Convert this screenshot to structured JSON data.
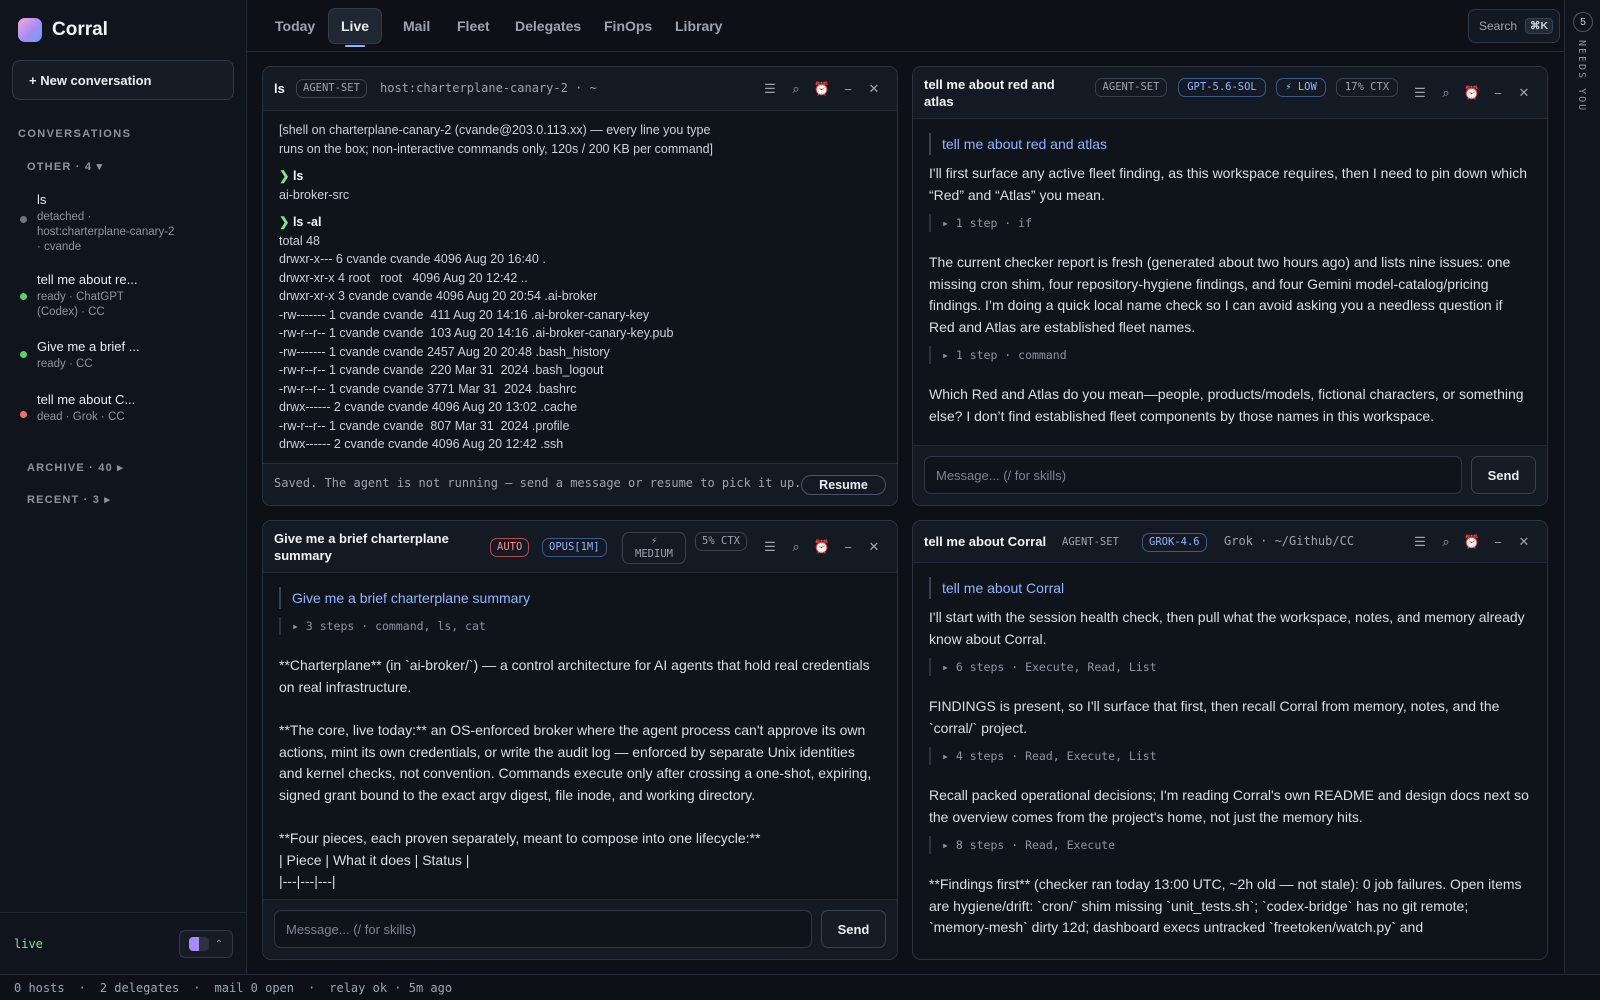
{
  "app": {
    "name": "Corral"
  },
  "sidebar": {
    "new_conversation": "+ New conversation",
    "conversations_label": "CONVERSATIONS",
    "groups": {
      "other": "OTHER · 4 ▾",
      "archive": "ARCHIVE · 40 ▸",
      "recent": "RECENT · 3 ▸"
    },
    "items": [
      {
        "title": "ls",
        "sub": "detached · host:charterplane-canary-2 · cvande",
        "status_color": "#6e7681"
      },
      {
        "title": "tell me about re...",
        "sub": "ready · ChatGPT (Codex) · CC",
        "status_color": "#56d364"
      },
      {
        "title": "Give me a brief ...",
        "sub": "ready · CC",
        "status_color": "#56d364"
      },
      {
        "title": "tell me about C...",
        "sub": "dead · Grok · CC",
        "status_color": "#f47067"
      }
    ],
    "footer": {
      "live_label": "live",
      "toggle_caret": "⌃"
    }
  },
  "nav": {
    "tabs": [
      "Today",
      "Live",
      "Mail",
      "Fleet",
      "Delegates",
      "FinOps",
      "Library"
    ],
    "active": "Live",
    "search_label": "Search",
    "search_kbd": "⌘K"
  },
  "rail": {
    "count": "5",
    "label": "NEEDS YOU"
  },
  "status": [
    "0 hosts",
    "·",
    "2 delegates",
    "·",
    "mail 0 open",
    "·",
    "relay ok · 5m ago"
  ],
  "panes": {
    "ls": {
      "title": "ls",
      "badge": "AGENT-SET",
      "host": "host:charterplane-canary-2 · ~",
      "banner": "[shell on charterplane-canary-2 (cvande@203.0.113.xx) — every line you type\nruns on the box; non-interactive commands only, 120s / 200 KB per command]",
      "cmd1": "ls",
      "out1": "ai-broker-src",
      "cmd2": "ls -al",
      "out2": "total 48\ndrwxr-x--- 6 cvande cvande 4096 Aug 20 16:40 .\ndrwxr-xr-x 4 root   root   4096 Aug 20 12:42 ..\ndrwxr-xr-x 3 cvande cvande 4096 Aug 20 20:54 .ai-broker\n-rw------- 1 cvande cvande  411 Aug 20 14:16 .ai-broker-canary-key\n-rw-r--r-- 1 cvande cvande  103 Aug 20 14:16 .ai-broker-canary-key.pub\n-rw------- 1 cvande cvande 2457 Aug 20 20:48 .bash_history\n-rw-r--r-- 1 cvande cvande  220 Mar 31  2024 .bash_logout\n-rw-r--r-- 1 cvande cvande 3771 Mar 31  2024 .bashrc\ndrwx------ 2 cvande cvande 4096 Aug 20 13:02 .cache\n-rw-r--r-- 1 cvande cvande  807 Mar 31  2024 .profile\ndrwx------ 2 cvande cvande 4096 Aug 20 12:42 .ssh",
      "footer_note": "Saved. The agent is not running — send a message or resume to pick it up.",
      "resume": "Resume"
    },
    "redatlas": {
      "title": "tell me about red and atlas",
      "badges": [
        "AGENT-SET",
        "GPT-5.6-SOL",
        "⚡ LOW",
        "17% CTX"
      ],
      "quote": "tell me about red and atlas",
      "p1": "I'll first surface any active fleet finding, as this workspace requires, then I need to pin down which “Red” and “Atlas” you mean.",
      "s1": "▸ 1 step · if",
      "p2": "The current checker report is fresh (generated about two hours ago) and lists nine issues: one missing cron shim, four repository-hygiene findings, and four Gemini model-catalog/pricing findings. I’m doing a quick local name check so I can avoid asking you a needless question if Red and Atlas are established fleet names.",
      "s2": "▸ 1 step · command",
      "p3": "Which Red and Atlas do you mean—people, products/models, fictional characters, or something else? I don’t find established fleet components by those names in this workspace.",
      "placeholder": "Message...  (/ for skills)",
      "send": "Send"
    },
    "charter": {
      "title": "Give me a brief charterplane summary",
      "badges": [
        "AUTO",
        "OPUS[1M]",
        "⚡ MEDIUM",
        "5% CTX"
      ],
      "quote": "Give me a brief charterplane summary",
      "s1": "▸ 3 steps · command, ls, cat",
      "p1": "**Charterplane** (in `ai-broker/`) — a control architecture for AI agents that hold real credentials on real infrastructure.",
      "p2": "**The core, live today:** an OS-enforced broker where the agent process can't approve its own actions, mint its own credentials, or write the audit log — enforced by separate Unix identities and kernel checks, not convention. Commands execute only after crossing a one-shot, expiring, signed grant bound to the exact argv digest, file inode, and working directory.",
      "p3a": "**Four pieces, each proven separately, meant to compose into one lifecycle:**",
      "p3b": "| Piece | What it does | Status |",
      "p3c": "|---|---|---|",
      "placeholder": "Message...  (/ for skills)",
      "send": "Send"
    },
    "corral": {
      "title": "tell me about Corral",
      "badges": [
        "AGENT-SET",
        "GROK-4.6"
      ],
      "meta": "Grok · ~/Github/CC",
      "quote": "tell me about Corral",
      "p1": "I'll start with the session health check, then pull what the workspace, notes, and memory already know about Corral.",
      "s1": "▸ 6 steps · Execute, Read, List",
      "p2": "FINDINGS is present, so I'll surface that first, then recall Corral from memory, notes, and the `corral/` project.",
      "s2": "▸ 4 steps · Read, Execute, List",
      "p3": "Recall packed operational decisions; I'm reading Corral's own README and design docs next so the overview comes from the project's home, not just the memory hits.",
      "s3": "▸ 8 steps · Read, Execute",
      "p4": "**Findings first** (checker ran today 13:00 UTC, ~2h old — not stale): 0 job failures. Open items are hygiene/drift: `cron/` shim missing `unit_tests.sh`; `codex-bridge` has no git remote; `memory-mesh` dirty 12d; dashboard execs untracked `freetoken/watch.py` and"
    }
  }
}
